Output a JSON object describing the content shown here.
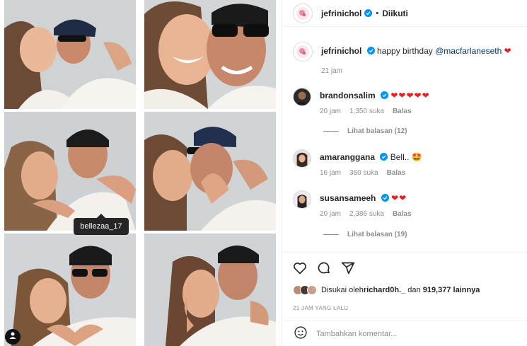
{
  "photos": {
    "tag_username": "bellezaa_17"
  },
  "post": {
    "author": "jefrinichol",
    "follow_status": "Diikuti",
    "dot": "•"
  },
  "caption": {
    "username": "jefrinichol",
    "text": "happy birthday ",
    "mention": "@macfarlaneseth",
    "emoji": "❤",
    "time": "21 jam"
  },
  "comments": [
    {
      "username": "brandonsalim",
      "text": "",
      "emoji": "❤❤❤❤❤",
      "time": "20 jam",
      "likes": "1,350 suka",
      "reply": "Balas",
      "view_replies": "Lihat balasan (12)"
    },
    {
      "username": "amaranggana",
      "text": "Bell.. ",
      "emoji": "🤩",
      "time": "16 jam",
      "likes": "360 suka",
      "reply": "Balas",
      "view_replies": ""
    },
    {
      "username": "susansameeh",
      "text": "",
      "emoji": "❤❤",
      "time": "20 jam",
      "likes": "2,386 suka",
      "reply": "Balas",
      "view_replies": "Lihat balasan (19)"
    }
  ],
  "likes": {
    "prefix": "Disukai oleh ",
    "user": "richard0h._",
    "middle": " dan ",
    "count": "919,377 lainnya"
  },
  "timestamp": "21 JAM YANG LALU",
  "add_comment": {
    "placeholder": "Tambahkan komentar..."
  },
  "colors": {
    "accent": "#0095f6",
    "heart": "#ed1c24",
    "muted": "#8e8e8e"
  }
}
